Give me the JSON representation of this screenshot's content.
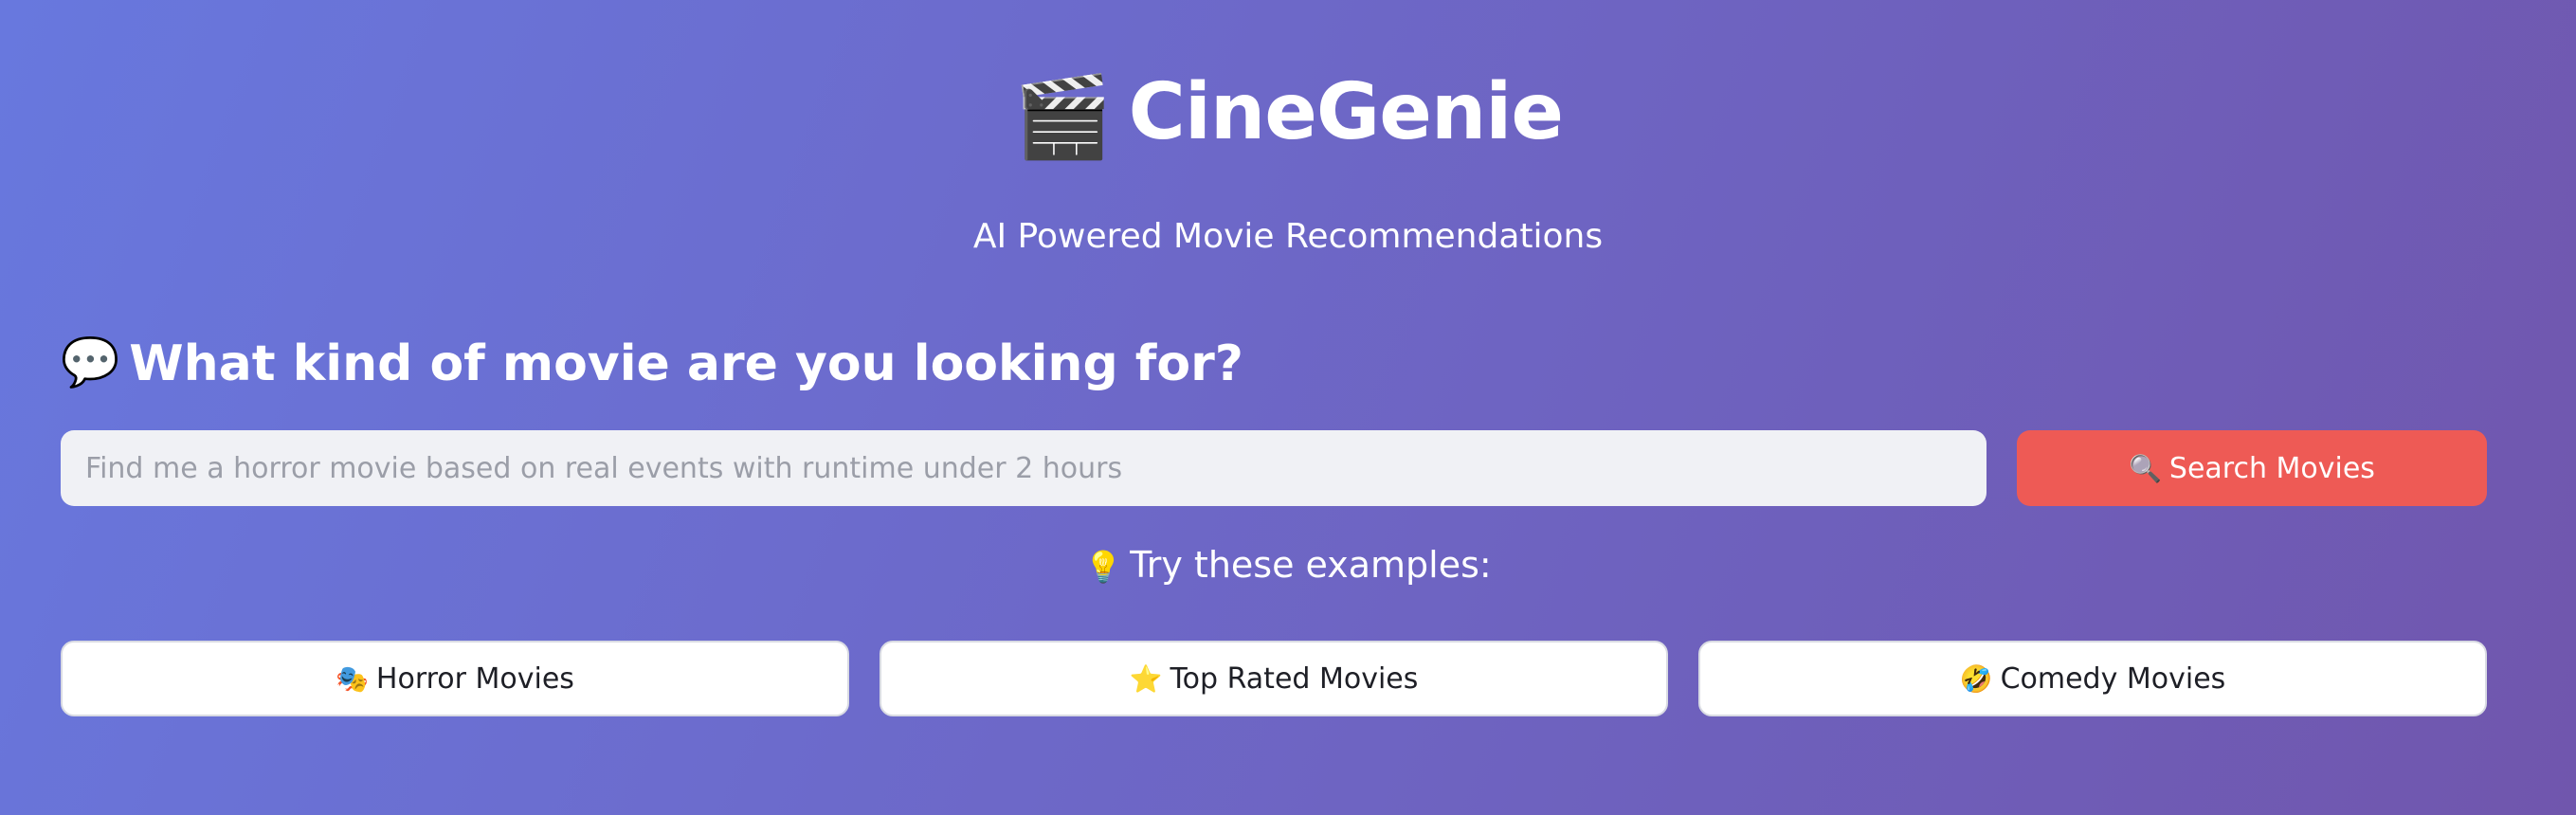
{
  "header": {
    "title_icon": "clapperboard-icon",
    "title_emoji": "🎬",
    "title": "CineGenie",
    "subtitle": "AI Powered Movie Recommendations"
  },
  "query": {
    "icon": "speech-bubble-icon",
    "emoji": "💬",
    "heading": "What kind of movie are you looking for?"
  },
  "search": {
    "value": "",
    "placeholder": "Find me a horror movie based on real events with runtime under 2 hours",
    "button_icon": "magnifier-icon",
    "button_emoji": "🔍",
    "button_label": "Search Movies"
  },
  "examples": {
    "icon": "lightbulb-icon",
    "emoji": "💡",
    "heading": "Try these examples:",
    "items": [
      {
        "icon": "theater-masks-icon",
        "emoji": "🎭",
        "label": "Horror Movies"
      },
      {
        "icon": "star-icon",
        "emoji": "⭐",
        "label": "Top Rated Movies"
      },
      {
        "icon": "laughing-face-icon",
        "emoji": "🤣",
        "label": "Comedy Movies"
      }
    ]
  },
  "colors": {
    "background_start": "#6878de",
    "background_end": "#7056ad",
    "accent": "#ee5a55",
    "input_bg": "#f0f1f5"
  }
}
